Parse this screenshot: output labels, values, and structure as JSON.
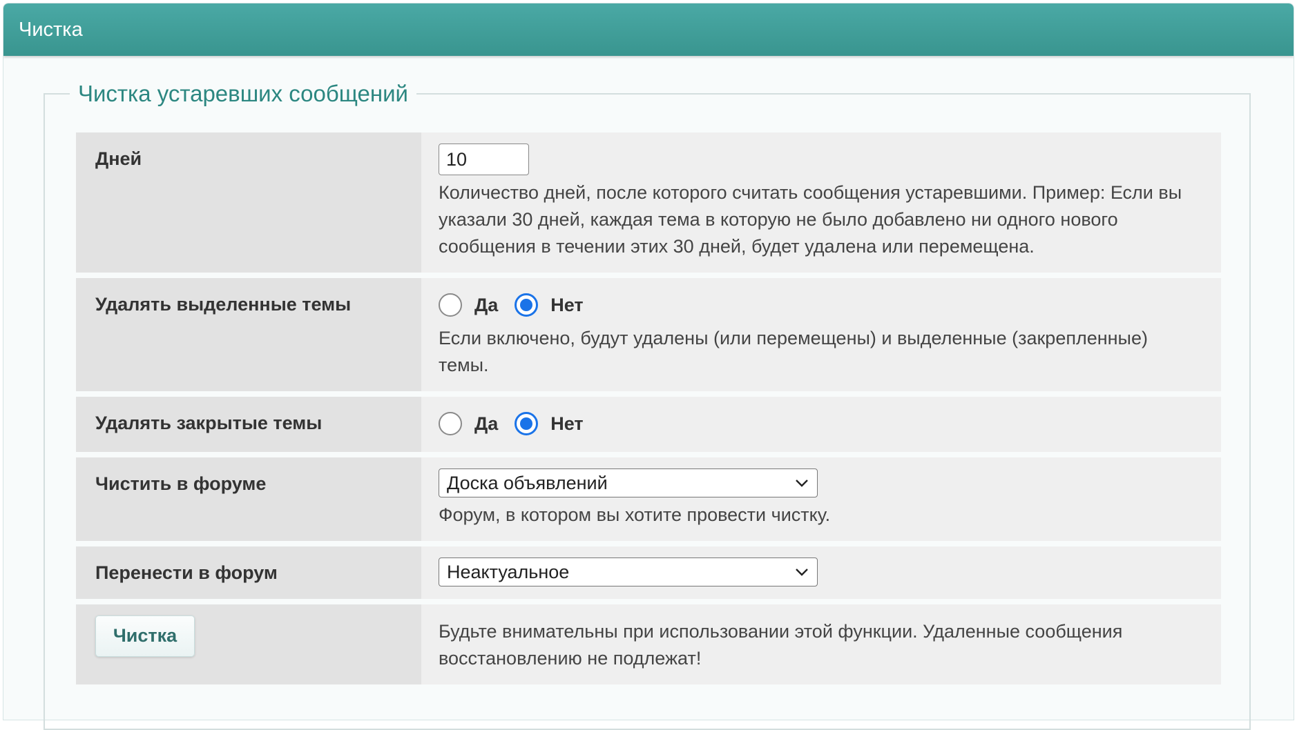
{
  "header": {
    "title": "Чистка"
  },
  "group": {
    "legend": "Чистка устаревших сообщений"
  },
  "days": {
    "label": "Дней",
    "value": "10",
    "description": "Количество дней, после которого считать сообщения устаревшими. Пример: Если вы указали 30 дней, каждая тема в которую не было добавлено ни одного нового сообщения в течении этих 30 дней, будет удалена или перемещена."
  },
  "sticky": {
    "label": "Удалять выделенные темы",
    "yes_label": "Да",
    "no_label": "Нет",
    "selected": "no",
    "description": "Если включено, будут удалены (или перемещены) и выделенные (закрепленные) темы."
  },
  "closed": {
    "label": "Удалять закрытые темы",
    "yes_label": "Да",
    "no_label": "Нет",
    "selected": "no"
  },
  "forum": {
    "label": "Чистить в форуме",
    "selected": "Доска объявлений",
    "description": "Форум, в котором вы хотите провести чистку."
  },
  "move_to": {
    "label": "Перенести в форум",
    "selected": "Неактуальное"
  },
  "submit": {
    "label": "Чистка",
    "warning": "Будьте внимательны при использовании этой функции. Удаленные сообщения восстановлению не подлежат!"
  },
  "colors": {
    "header": "#3f9e99",
    "accent": "#2c8781",
    "radio_checked": "#1a73e8"
  }
}
